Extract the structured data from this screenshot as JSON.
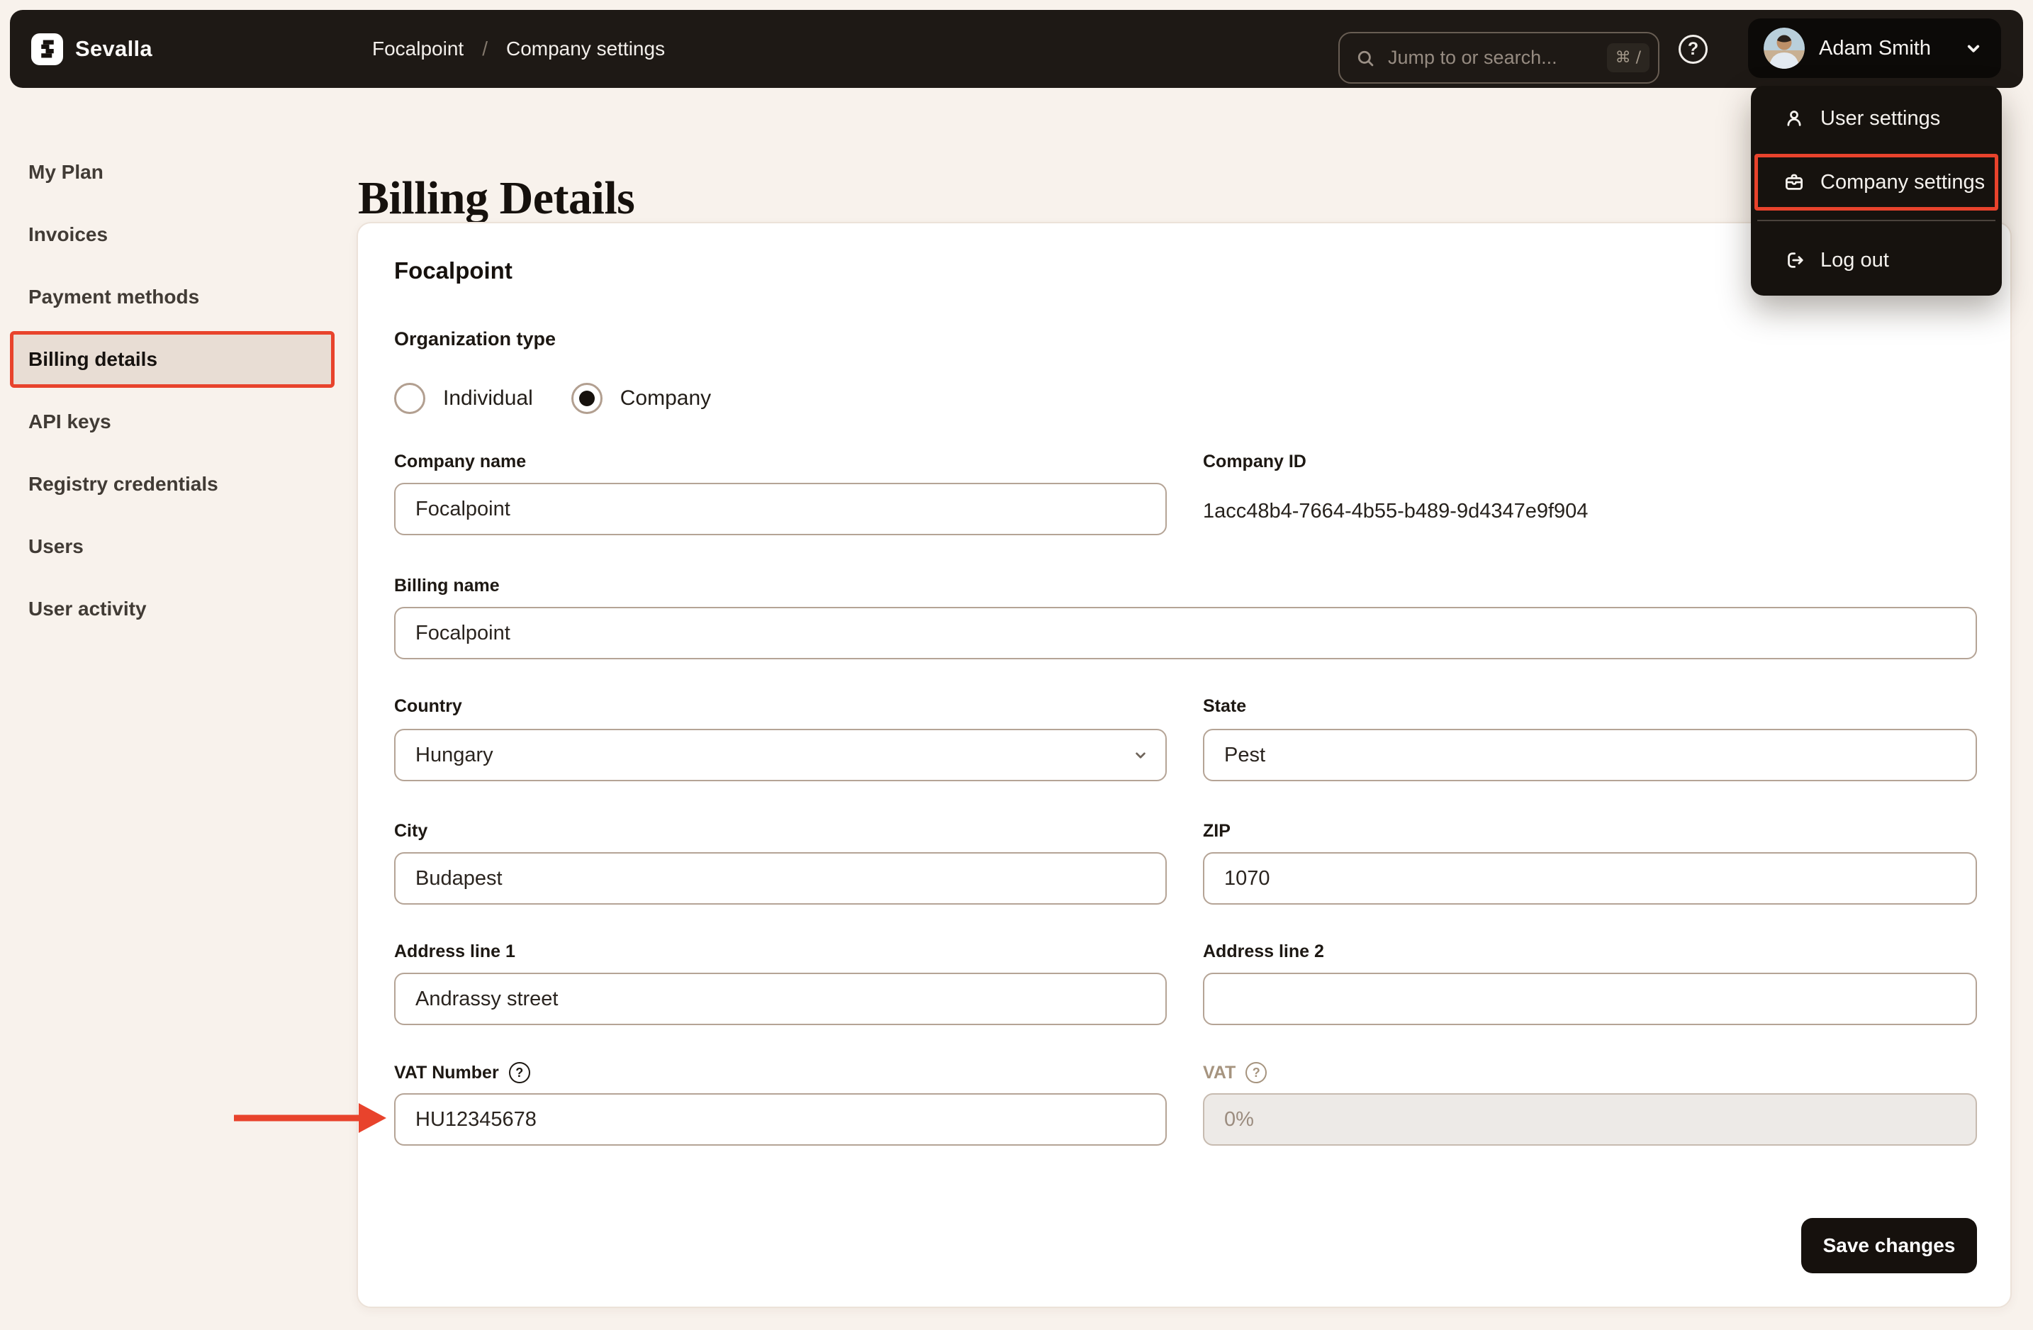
{
  "header": {
    "brand": "Sevalla",
    "breadcrumb": {
      "parent": "Focalpoint",
      "separator": "/",
      "current": "Company settings"
    },
    "search": {
      "placeholder": "Jump to or search...",
      "shortcut": "⌘ /"
    },
    "user": {
      "name": "Adam Smith"
    }
  },
  "user_menu": {
    "items": [
      {
        "label": "User settings",
        "highlighted": false
      },
      {
        "label": "Company settings",
        "highlighted": true
      },
      {
        "label": "Log out",
        "highlighted": false
      }
    ]
  },
  "sidebar": {
    "items": [
      {
        "label": "My Plan",
        "active": false
      },
      {
        "label": "Invoices",
        "active": false
      },
      {
        "label": "Payment methods",
        "active": false
      },
      {
        "label": "Billing details",
        "active": true
      },
      {
        "label": "API keys",
        "active": false
      },
      {
        "label": "Registry credentials",
        "active": false
      },
      {
        "label": "Users",
        "active": false
      },
      {
        "label": "User activity",
        "active": false
      }
    ]
  },
  "page": {
    "title": "Billing Details"
  },
  "card": {
    "heading": "Focalpoint",
    "organization_type": {
      "label": "Organization type",
      "options": [
        {
          "label": "Individual",
          "selected": false
        },
        {
          "label": "Company",
          "selected": true
        }
      ]
    },
    "fields": {
      "company_name": {
        "label": "Company name",
        "value": "Focalpoint"
      },
      "company_id": {
        "label": "Company ID",
        "value": "1acc48b4-7664-4b55-b489-9d4347e9f904"
      },
      "billing_name": {
        "label": "Billing name",
        "value": "Focalpoint"
      },
      "country": {
        "label": "Country",
        "value": "Hungary"
      },
      "state": {
        "label": "State",
        "value": "Pest"
      },
      "city": {
        "label": "City",
        "value": "Budapest"
      },
      "zip": {
        "label": "ZIP",
        "value": "1070"
      },
      "address1": {
        "label": "Address line 1",
        "value": "Andrassy street"
      },
      "address2": {
        "label": "Address line 2",
        "value": ""
      },
      "vat_number": {
        "label": "VAT Number",
        "value": "HU12345678"
      },
      "vat": {
        "label": "VAT",
        "value": "0%"
      }
    },
    "save_button": "Save changes"
  },
  "icons": {
    "help_glyph": "?"
  },
  "colors": {
    "annotation_red": "#e8432c",
    "header_bg": "#1e1915",
    "page_bg": "#f8f2ec",
    "save_button_bg": "#16110d"
  }
}
